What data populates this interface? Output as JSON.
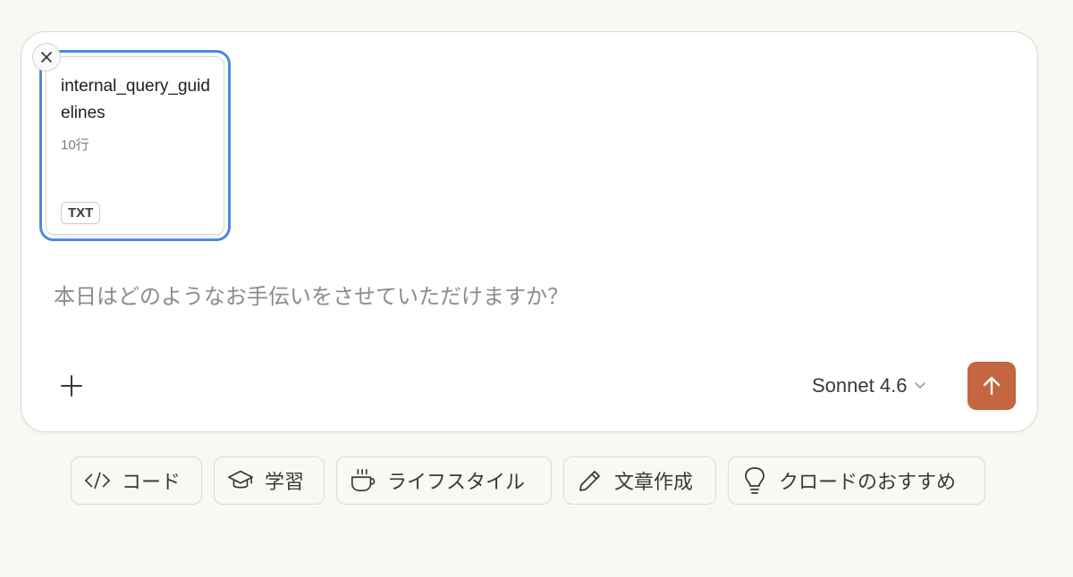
{
  "attachment": {
    "name": "internal_query_guidelines",
    "meta": "10行",
    "type": "TXT"
  },
  "prompt": {
    "placeholder": "本日はどのようなお手伝いをさせていただけますか？",
    "value": ""
  },
  "toolbar": {
    "model": "Sonnet 4.6"
  },
  "colors": {
    "accent": "#c4663f",
    "selection": "#4a8be0",
    "background": "#f9f8f4"
  },
  "chips": [
    {
      "label": "コード",
      "icon": "code-icon"
    },
    {
      "label": "学習",
      "icon": "graduation-cap-icon"
    },
    {
      "label": "ライフスタイル",
      "icon": "coffee-cup-icon"
    },
    {
      "label": "文章作成",
      "icon": "pencil-icon"
    },
    {
      "label": "クロードのおすすめ",
      "icon": "lightbulb-icon"
    }
  ]
}
